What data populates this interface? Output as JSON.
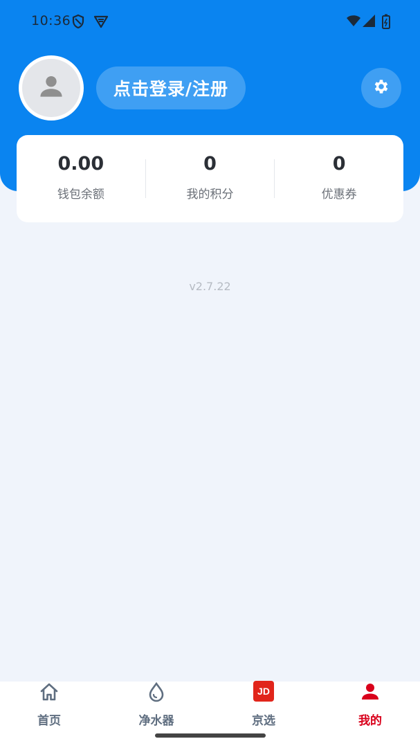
{
  "status_bar": {
    "time": "10:36",
    "icons": [
      "shield-icon",
      "vpn-badge-icon",
      "wifi-icon",
      "signal-icon",
      "battery-icon"
    ]
  },
  "profile": {
    "avatar_icon": "person-icon",
    "login_label": "点击登录/注册",
    "settings_icon": "gear-icon"
  },
  "stats": [
    {
      "value": "0.00",
      "label": "钱包余额"
    },
    {
      "value": "0",
      "label": "我的积分"
    },
    {
      "value": "0",
      "label": "优惠券"
    }
  ],
  "version": "v2.7.22",
  "tabs": [
    {
      "label": "首页",
      "icon": "home-icon",
      "active": false
    },
    {
      "label": "净水器",
      "icon": "water-drop-icon",
      "active": false
    },
    {
      "label": "京选",
      "icon": "jd-logo-icon",
      "badge": "JD",
      "active": false
    },
    {
      "label": "我的",
      "icon": "person-icon",
      "active": true
    }
  ],
  "colors": {
    "primary": "#0A84F0",
    "background": "#F0F4FB",
    "active_tab": "#D9001B",
    "jd_red": "#E1251B"
  }
}
